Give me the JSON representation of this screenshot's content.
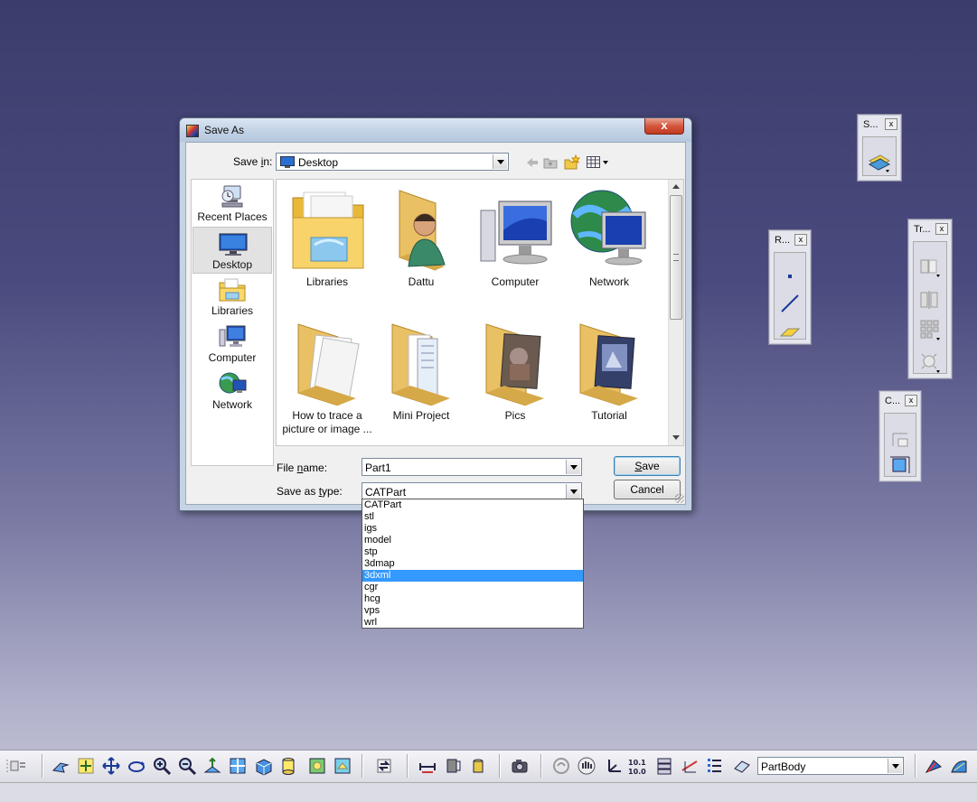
{
  "dialog": {
    "title": "Save As",
    "close_glyph": "x",
    "save_in_label_prefix": "Save ",
    "save_in_label_hotkey": "i",
    "save_in_label_suffix": "n:",
    "save_in_value": "Desktop",
    "places": [
      {
        "label": "Recent Places",
        "icon": "recent-places-icon"
      },
      {
        "label": "Desktop",
        "icon": "desktop-icon",
        "selected": true
      },
      {
        "label": "Libraries",
        "icon": "libraries-icon"
      },
      {
        "label": "Computer",
        "icon": "computer-icon"
      },
      {
        "label": "Network",
        "icon": "network-icon"
      }
    ],
    "items": [
      {
        "name": "Libraries",
        "icon": "libraries-folder-icon"
      },
      {
        "name": "Dattu",
        "icon": "user-folder-icon"
      },
      {
        "name": "Computer",
        "icon": "computer-icon"
      },
      {
        "name": "Network",
        "icon": "network-icon"
      },
      {
        "name": "How to trace a picture or image ...",
        "icon": "folder-icon"
      },
      {
        "name": "Mini Project",
        "icon": "folder-icon"
      },
      {
        "name": "Pics",
        "icon": "folder-icon"
      },
      {
        "name": "Tutorial",
        "icon": "folder-icon"
      }
    ],
    "file_name_label_prefix": "File ",
    "file_name_label_hotkey": "n",
    "file_name_label_suffix": "ame:",
    "file_name_value": "Part1",
    "save_type_label_prefix": "Save as ",
    "save_type_label_hotkey": "t",
    "save_type_label_suffix": "ype:",
    "save_type_value": "CATPart",
    "save_button_hotkey": "S",
    "save_button_rest": "ave",
    "cancel_button": "Cancel"
  },
  "type_options": [
    "CATPart",
    "stl",
    "igs",
    "model",
    "stp",
    "3dmap",
    "3dxml",
    "cgr",
    "hcg",
    "vps",
    "wrl"
  ],
  "type_options_highlighted": 6,
  "toolbars": {
    "sketch_title": "S...",
    "reference_title": "R...",
    "transform_title": "Tr...",
    "constraint_title": "C...",
    "close_glyph": "x"
  },
  "bottom": {
    "body_selector_value": "PartBody"
  },
  "colors": {
    "highlight": "#3399ff",
    "background_top": "#3c3c6c",
    "background_bottom": "#c4c4d6"
  }
}
